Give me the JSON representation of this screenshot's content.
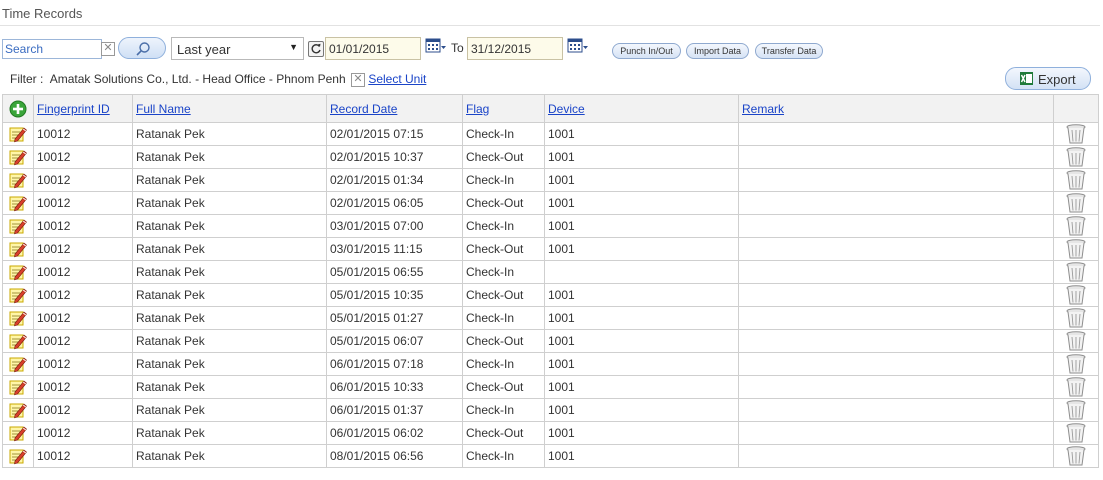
{
  "page": {
    "title": "Time Records"
  },
  "toolbar": {
    "search_placeholder": "Search",
    "clear_symbol": "✕",
    "period": "Last year",
    "date_from": "01/01/2015",
    "to_label": "To",
    "date_to": "31/12/2015",
    "punch_label": "Punch In/Out",
    "import_label": "Import Data",
    "transfer_label": "Transfer Data"
  },
  "filter": {
    "prefix": "Filter :",
    "unit": "Amatak Solutions Co., Ltd. - Head Office - Phnom Penh",
    "select_unit_label": "Select Unit"
  },
  "export": {
    "label": "Export"
  },
  "table": {
    "columns": [
      "Fingerprint ID",
      "Full Name",
      "Record Date",
      "Flag",
      "Device",
      "Remark"
    ],
    "rows": [
      {
        "id": "10012",
        "name": "Ratanak Pek",
        "date": "02/01/2015 07:15",
        "flag": "Check-In",
        "device": "1001",
        "remark": ""
      },
      {
        "id": "10012",
        "name": "Ratanak Pek",
        "date": "02/01/2015 10:37",
        "flag": "Check-Out",
        "device": "1001",
        "remark": ""
      },
      {
        "id": "10012",
        "name": "Ratanak Pek",
        "date": "02/01/2015 01:34",
        "flag": "Check-In",
        "device": "1001",
        "remark": ""
      },
      {
        "id": "10012",
        "name": "Ratanak Pek",
        "date": "02/01/2015 06:05",
        "flag": "Check-Out",
        "device": "1001",
        "remark": ""
      },
      {
        "id": "10012",
        "name": "Ratanak Pek",
        "date": "03/01/2015 07:00",
        "flag": "Check-In",
        "device": "1001",
        "remark": ""
      },
      {
        "id": "10012",
        "name": "Ratanak Pek",
        "date": "03/01/2015 11:15",
        "flag": "Check-Out",
        "device": "1001",
        "remark": ""
      },
      {
        "id": "10012",
        "name": "Ratanak Pek",
        "date": "05/01/2015 06:55",
        "flag": "Check-In",
        "device": "",
        "remark": ""
      },
      {
        "id": "10012",
        "name": "Ratanak Pek",
        "date": "05/01/2015 10:35",
        "flag": "Check-Out",
        "device": "1001",
        "remark": ""
      },
      {
        "id": "10012",
        "name": "Ratanak Pek",
        "date": "05/01/2015 01:27",
        "flag": "Check-In",
        "device": "1001",
        "remark": ""
      },
      {
        "id": "10012",
        "name": "Ratanak Pek",
        "date": "05/01/2015 06:07",
        "flag": "Check-Out",
        "device": "1001",
        "remark": ""
      },
      {
        "id": "10012",
        "name": "Ratanak Pek",
        "date": "06/01/2015 07:18",
        "flag": "Check-In",
        "device": "1001",
        "remark": ""
      },
      {
        "id": "10012",
        "name": "Ratanak Pek",
        "date": "06/01/2015 10:33",
        "flag": "Check-Out",
        "device": "1001",
        "remark": ""
      },
      {
        "id": "10012",
        "name": "Ratanak Pek",
        "date": "06/01/2015 01:37",
        "flag": "Check-In",
        "device": "1001",
        "remark": ""
      },
      {
        "id": "10012",
        "name": "Ratanak Pek",
        "date": "06/01/2015 06:02",
        "flag": "Check-Out",
        "device": "1001",
        "remark": ""
      },
      {
        "id": "10012",
        "name": "Ratanak Pek",
        "date": "08/01/2015 06:56",
        "flag": "Check-In",
        "device": "1001",
        "remark": ""
      }
    ]
  },
  "icons": {
    "add": "add-circle-icon",
    "edit": "edit-note-icon",
    "delete": "trash-icon",
    "search": "magnifier-icon",
    "calendar": "calendar-icon",
    "refresh": "refresh-icon",
    "excel": "excel-icon"
  },
  "colors": {
    "link": "#1a44c8",
    "add_green": "#3aa53a",
    "header_bg": "#f2f2f2",
    "date_field_bg": "#fdfbea"
  }
}
